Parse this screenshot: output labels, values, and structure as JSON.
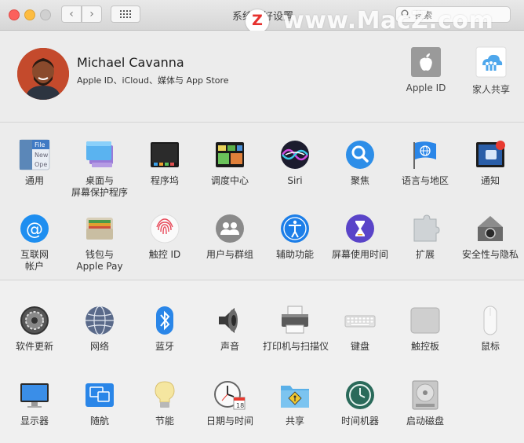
{
  "window": {
    "title": "系统偏好设置",
    "search_placeholder": "搜索",
    "watermark": "www.MacZ.com",
    "watermark_logo": "Z"
  },
  "user": {
    "name": "Michael Cavanna",
    "subtitle": "Apple ID、iCloud、媒体与 App Store",
    "apple_id_label": "Apple ID",
    "family_label": "家人共享"
  },
  "section1": [
    {
      "label": "通用",
      "icon": "general-icon"
    },
    {
      "label": "桌面与\n屏幕保护程序",
      "icon": "desktop-screensaver-icon"
    },
    {
      "label": "程序坞",
      "icon": "dock-icon"
    },
    {
      "label": "调度中心",
      "icon": "mission-control-icon"
    },
    {
      "label": "Siri",
      "icon": "siri-icon"
    },
    {
      "label": "聚焦",
      "icon": "spotlight-icon"
    },
    {
      "label": "语言与地区",
      "icon": "language-region-icon"
    },
    {
      "label": "通知",
      "icon": "notifications-icon"
    },
    {
      "label": "互联网\n帐户",
      "icon": "internet-accounts-icon"
    },
    {
      "label": "钱包与\nApple Pay",
      "icon": "wallet-applepay-icon"
    },
    {
      "label": "触控 ID",
      "icon": "touch-id-icon"
    },
    {
      "label": "用户与群组",
      "icon": "users-groups-icon"
    },
    {
      "label": "辅助功能",
      "icon": "accessibility-icon"
    },
    {
      "label": "屏幕使用时间",
      "icon": "screen-time-icon"
    },
    {
      "label": "扩展",
      "icon": "extensions-icon"
    },
    {
      "label": "安全性与隐私",
      "icon": "security-privacy-icon"
    }
  ],
  "section2": [
    {
      "label": "软件更新",
      "icon": "software-update-icon"
    },
    {
      "label": "网络",
      "icon": "network-icon"
    },
    {
      "label": "蓝牙",
      "icon": "bluetooth-icon"
    },
    {
      "label": "声音",
      "icon": "sound-icon"
    },
    {
      "label": "打印机与扫描仪",
      "icon": "printers-scanners-icon"
    },
    {
      "label": "键盘",
      "icon": "keyboard-icon"
    },
    {
      "label": "触控板",
      "icon": "trackpad-icon"
    },
    {
      "label": "鼠标",
      "icon": "mouse-icon"
    },
    {
      "label": "显示器",
      "icon": "displays-icon"
    },
    {
      "label": "随航",
      "icon": "sidecar-icon"
    },
    {
      "label": "节能",
      "icon": "energy-saver-icon"
    },
    {
      "label": "日期与时间",
      "icon": "date-time-icon"
    },
    {
      "label": "共享",
      "icon": "sharing-icon"
    },
    {
      "label": "时间机器",
      "icon": "time-machine-icon"
    },
    {
      "label": "启动磁盘",
      "icon": "startup-disk-icon"
    }
  ],
  "colors": {
    "close": "#fc605c",
    "minimize": "#fdbc40",
    "accent_blue": "#1a8ef5"
  }
}
